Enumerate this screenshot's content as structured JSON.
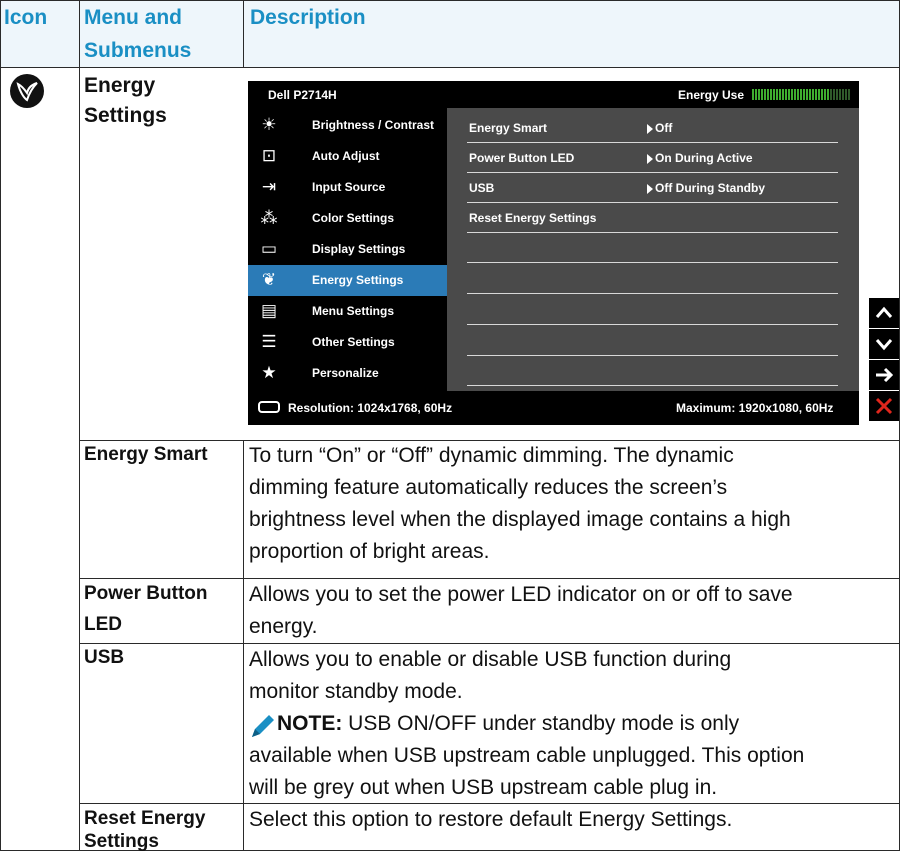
{
  "header": {
    "col_icon": "Icon",
    "col_menu_line1": "Menu and",
    "col_menu_line2": "Submenus",
    "col_desc": "Description"
  },
  "main_row": {
    "title_line1": "Energy",
    "title_line2": "Settings",
    "icon": "leaf-energy-icon"
  },
  "osd": {
    "model": "Dell P2714H",
    "energy_use_label": "Energy Use",
    "energy_use_level": 0.8,
    "menu_items": [
      {
        "label": "Brightness / Contrast",
        "icon": "brightness-icon",
        "glyph": "☀"
      },
      {
        "label": "Auto Adjust",
        "icon": "auto-adjust-icon",
        "glyph": "⊡"
      },
      {
        "label": "Input Source",
        "icon": "input-source-icon",
        "glyph": "⇥"
      },
      {
        "label": "Color Settings",
        "icon": "color-settings-icon",
        "glyph": "⁂"
      },
      {
        "label": "Display Settings",
        "icon": "display-settings-icon",
        "glyph": "▭"
      },
      {
        "label": "Energy Settings",
        "icon": "leaf-icon",
        "glyph": "❦"
      },
      {
        "label": "Menu Settings",
        "icon": "menu-settings-icon",
        "glyph": "▤"
      },
      {
        "label": "Other Settings",
        "icon": "other-settings-icon",
        "glyph": "☰"
      },
      {
        "label": "Personalize",
        "icon": "star-icon",
        "glyph": "★"
      }
    ],
    "selected_index": 5,
    "submenu": [
      {
        "label": "Energy Smart",
        "value": "Off"
      },
      {
        "label": "Power Button LED",
        "value": "On During Active"
      },
      {
        "label": "USB",
        "value": "Off During Standby"
      },
      {
        "label": "Reset Energy Settings",
        "value": ""
      }
    ],
    "resolution": "Resolution: 1024x1768, 60Hz",
    "maximum": "Maximum: 1920x1080, 60Hz",
    "nav_buttons": [
      {
        "name": "up-arrow-button",
        "glyph": "^"
      },
      {
        "name": "down-arrow-button",
        "glyph": "v"
      },
      {
        "name": "right-arrow-button",
        "glyph": "→"
      },
      {
        "name": "close-button",
        "glyph": "×"
      }
    ]
  },
  "rows": [
    {
      "title": "Energy Smart",
      "lines": [
        "To turn “On” or “Off” dynamic dimming. The dynamic",
        "dimming feature automatically reduces the screen’s",
        "brightness level when the displayed image contains a high",
        "proportion of bright areas."
      ]
    },
    {
      "title_line1": "Power Button",
      "title_line2": "LED",
      "lines": [
        "Allows you to set the power LED indicator on or off to save",
        "energy."
      ]
    },
    {
      "title": "USB",
      "lines": [
        "Allows you to enable or disable USB function during",
        "monitor standby mode."
      ],
      "note_label": "NOTE:",
      "note_lines": [
        " USB ON/OFF under standby mode is only",
        "available when USB upstream cable unplugged. This option",
        "will be grey out when USB upstream cable plug in."
      ]
    },
    {
      "title_line1": "Reset Energy",
      "title_line2": "Settings",
      "lines": [
        "Select this option to restore default Energy Settings."
      ]
    }
  ]
}
